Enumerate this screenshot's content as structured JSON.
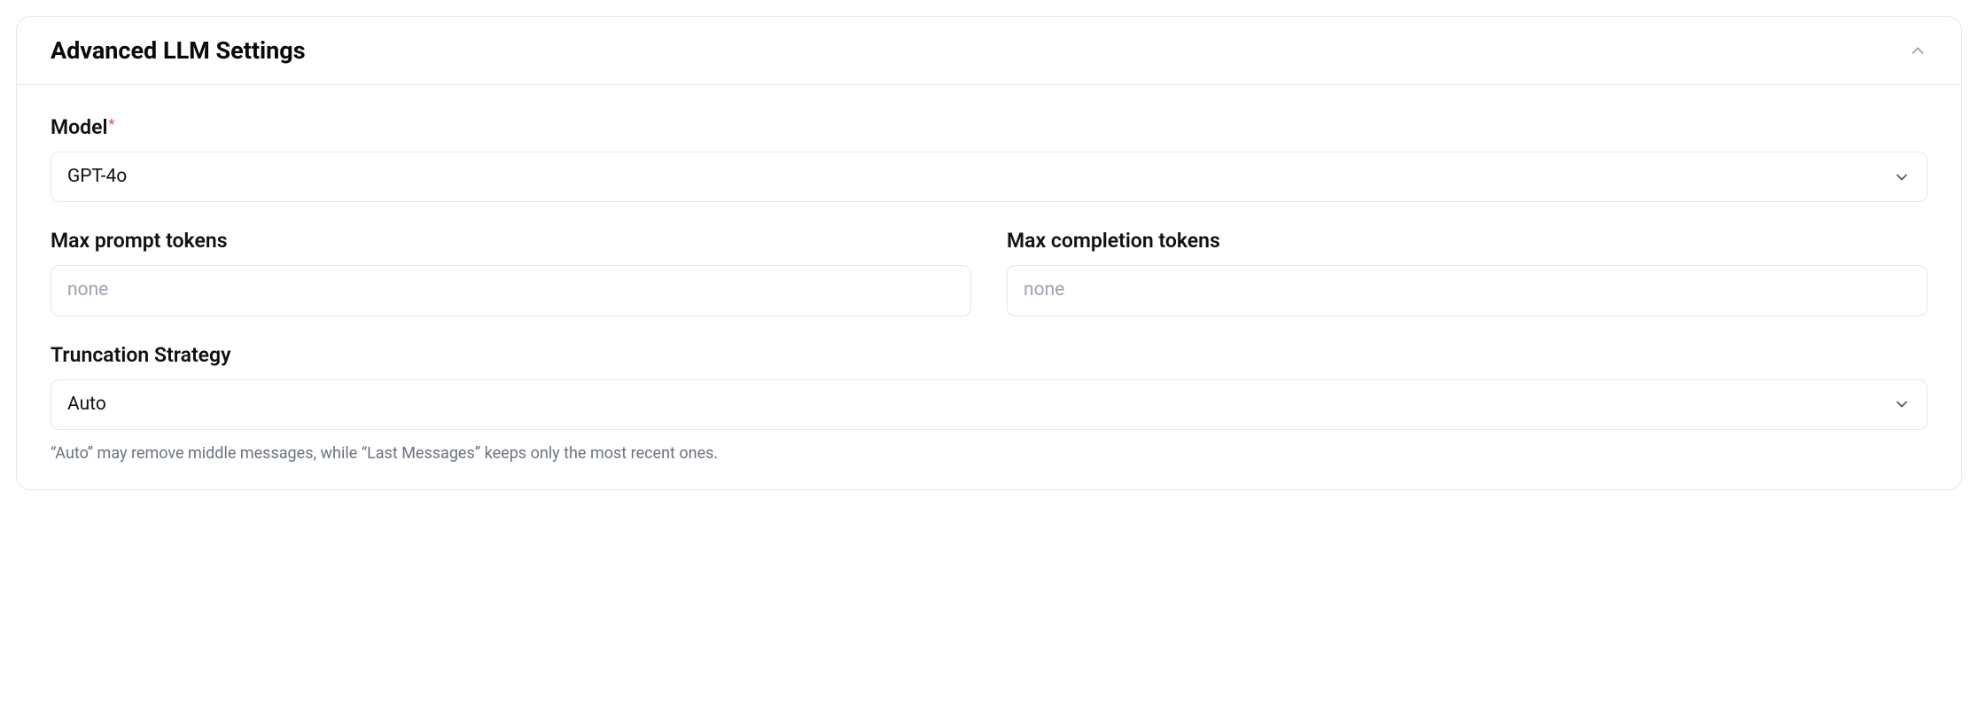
{
  "panel": {
    "title": "Advanced LLM Settings"
  },
  "fields": {
    "model": {
      "label": "Model",
      "required_marker": "*",
      "value": "GPT-4o"
    },
    "max_prompt_tokens": {
      "label": "Max prompt tokens",
      "placeholder": "none",
      "value": ""
    },
    "max_completion_tokens": {
      "label": "Max completion tokens",
      "placeholder": "none",
      "value": ""
    },
    "truncation_strategy": {
      "label": "Truncation Strategy",
      "value": "Auto",
      "help": "“Auto” may remove middle messages, while “Last Messages” keeps only the most recent ones."
    }
  }
}
